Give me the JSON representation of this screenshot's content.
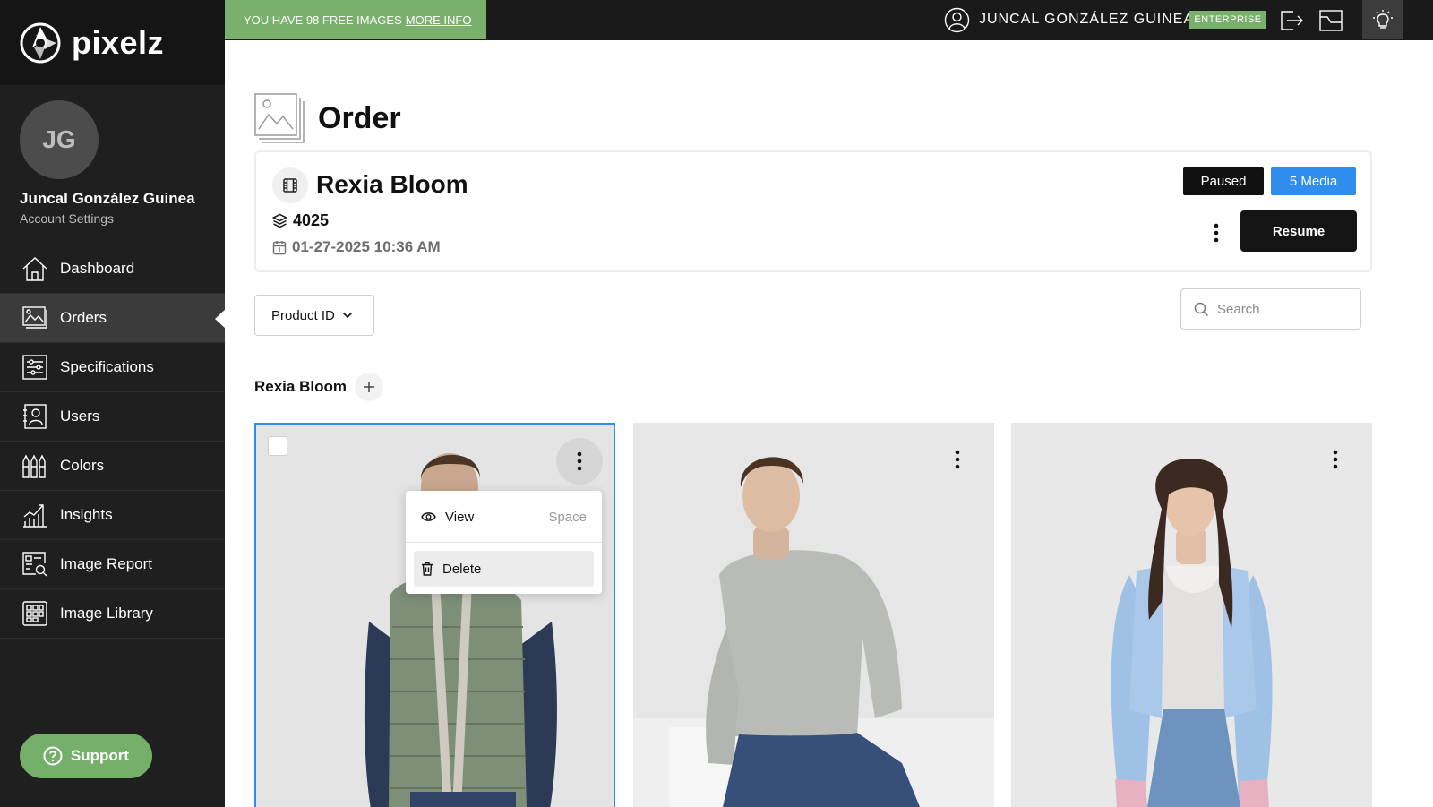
{
  "app": {
    "logo_text": "pixelz"
  },
  "user": {
    "initials": "JG",
    "name": "Juncal González Guinea",
    "account_settings": "Account Settings"
  },
  "sidebar": {
    "items": [
      {
        "label": "Dashboard",
        "icon": "home-icon"
      },
      {
        "label": "Orders",
        "icon": "orders-icon",
        "active": true
      },
      {
        "label": "Specifications",
        "icon": "specifications-icon"
      },
      {
        "label": "Users",
        "icon": "users-icon"
      },
      {
        "label": "Colors",
        "icon": "colors-icon"
      },
      {
        "label": "Insights",
        "icon": "insights-icon"
      },
      {
        "label": "Image Report",
        "icon": "image-report-icon"
      },
      {
        "label": "Image Library",
        "icon": "image-library-icon"
      }
    ],
    "support_label": "Support"
  },
  "topbar": {
    "free_images_text": "YOU HAVE 98 FREE IMAGES",
    "more_info_link": "MORE INFO",
    "user_name": "JUNCAL GONZÁLEZ GUINEA",
    "plan_badge": "ENTERPRISE",
    "icons": [
      "user-icon",
      "logout-icon",
      "inbox-icon",
      "lightbulb-icon"
    ]
  },
  "page": {
    "title": "Order"
  },
  "order": {
    "name": "Rexia Bloom",
    "count": "4025",
    "date": "01-27-2025 10:36 AM",
    "status": "Paused",
    "media": "5 Media",
    "resume_label": "Resume"
  },
  "filters": {
    "product_filter_label": "Product ID",
    "search_placeholder": "Search",
    "search_value": ""
  },
  "group": {
    "title": "Rexia Bloom"
  },
  "media_tiles": [
    {
      "selected": true,
      "menu_open": true
    },
    {
      "selected": false,
      "menu_open": false
    },
    {
      "selected": false,
      "menu_open": false
    }
  ],
  "context_menu": {
    "items": [
      {
        "label": "View",
        "shortcut": "Space",
        "icon": "eye-icon"
      },
      {
        "label": "Delete",
        "shortcut": "",
        "icon": "trash-icon"
      }
    ]
  },
  "colors": {
    "accent_green": "#79b06c",
    "accent_blue": "#2f8eed",
    "sidebar_bg": "#1f1f1f",
    "topbar_bg": "#1a1a1a"
  }
}
